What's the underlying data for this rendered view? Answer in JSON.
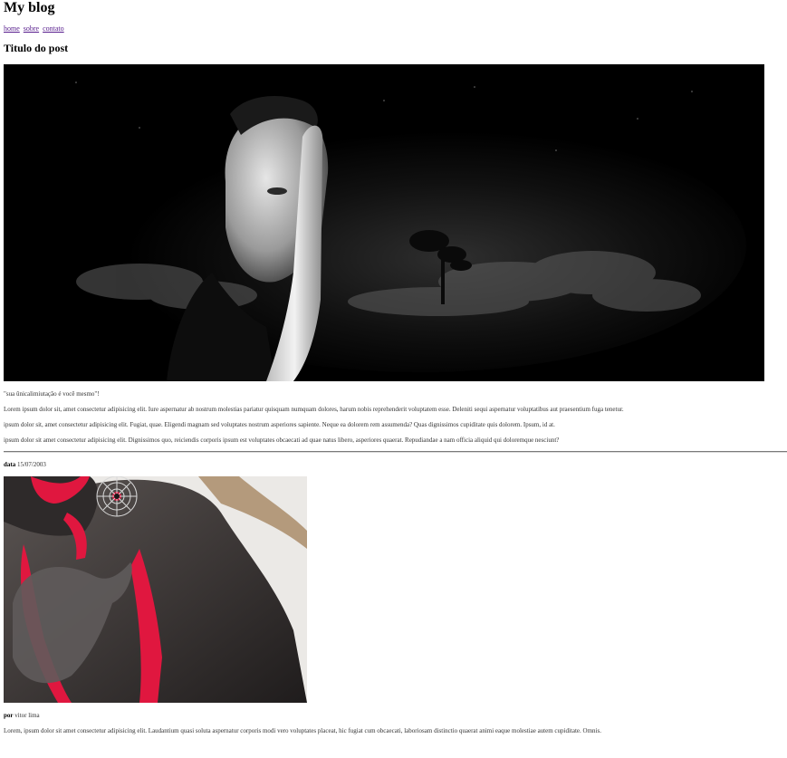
{
  "site": {
    "title": "My blog"
  },
  "nav": {
    "items": [
      "home",
      "sobre",
      "contato"
    ]
  },
  "post": {
    "title": "Titulo do post",
    "quote": "\"sua ûnicalimiutação é você mesmo\"!",
    "paragraphs": [
      "Lorem ipsum dolor sit, amet consectetur adipisicing elit. Iure aspernatur ab nostrum molestias pariatur quisquam numquam dolores, harum nobis reprehenderit voluptatem esse. Deleniti sequi aspernatur voluptatibus aut praesentium fuga tenetur.",
      "ipsum dolor sit, amet consectetur adipisicing elit. Fugiat, quae. Eligendi magnam sed voluptates nostrum asperiores sapiente. Neque ea dolorem rem assumenda? Quas dignissimos cupiditate quis dolorem. Ipsum, id at.",
      "ipsum dolor sit amet consectetur adipisicing elit. Dignissimos quo, reiciendis corporis ipsum est voluptates obcaecati ad quae natus libero, asperiores quaerat. Repudiandae a nam officia aliquid qui doloremque nesciunt?"
    ]
  },
  "meta": {
    "date_label": "data",
    "date_value": "15/07/2003",
    "author_label": "por",
    "author_value": "vitor lima"
  },
  "footer_paragraph": "Lorem, ipsum dolor sit amet consectetur adipisicing elit. Laudantium quasi soluta aspernatur corporis modi vero voluptates placeat, hic fugiat cum obcaecati, laboriosam distinctio quaerat animi eaque molestiae autem cupiditate. Omnis.",
  "colors": {
    "link_visited": "#551a8b",
    "hero_bg": "#000000",
    "paint_red": "#e0173f"
  }
}
